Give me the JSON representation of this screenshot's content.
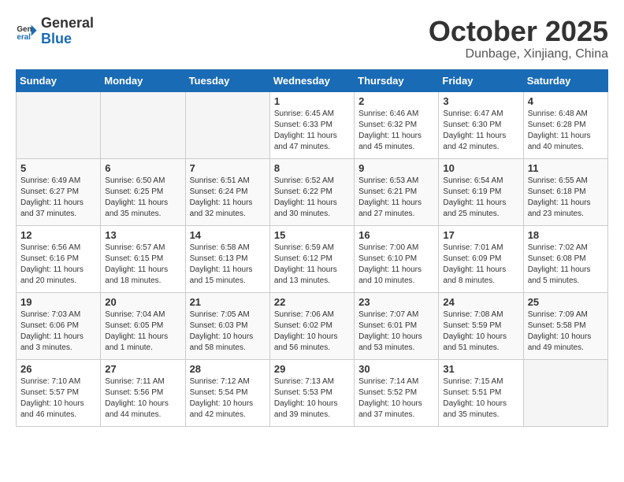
{
  "header": {
    "logo_line1": "General",
    "logo_line2": "Blue",
    "title": "October 2025",
    "subtitle": "Dunbage, Xinjiang, China"
  },
  "days_of_week": [
    "Sunday",
    "Monday",
    "Tuesday",
    "Wednesday",
    "Thursday",
    "Friday",
    "Saturday"
  ],
  "weeks": [
    [
      {
        "day": "",
        "empty": true
      },
      {
        "day": "",
        "empty": true
      },
      {
        "day": "",
        "empty": true
      },
      {
        "day": "1",
        "sunrise": "6:45 AM",
        "sunset": "6:33 PM",
        "daylight": "11 hours and 47 minutes."
      },
      {
        "day": "2",
        "sunrise": "6:46 AM",
        "sunset": "6:32 PM",
        "daylight": "11 hours and 45 minutes."
      },
      {
        "day": "3",
        "sunrise": "6:47 AM",
        "sunset": "6:30 PM",
        "daylight": "11 hours and 42 minutes."
      },
      {
        "day": "4",
        "sunrise": "6:48 AM",
        "sunset": "6:28 PM",
        "daylight": "11 hours and 40 minutes."
      }
    ],
    [
      {
        "day": "5",
        "sunrise": "6:49 AM",
        "sunset": "6:27 PM",
        "daylight": "11 hours and 37 minutes."
      },
      {
        "day": "6",
        "sunrise": "6:50 AM",
        "sunset": "6:25 PM",
        "daylight": "11 hours and 35 minutes."
      },
      {
        "day": "7",
        "sunrise": "6:51 AM",
        "sunset": "6:24 PM",
        "daylight": "11 hours and 32 minutes."
      },
      {
        "day": "8",
        "sunrise": "6:52 AM",
        "sunset": "6:22 PM",
        "daylight": "11 hours and 30 minutes."
      },
      {
        "day": "9",
        "sunrise": "6:53 AM",
        "sunset": "6:21 PM",
        "daylight": "11 hours and 27 minutes."
      },
      {
        "day": "10",
        "sunrise": "6:54 AM",
        "sunset": "6:19 PM",
        "daylight": "11 hours and 25 minutes."
      },
      {
        "day": "11",
        "sunrise": "6:55 AM",
        "sunset": "6:18 PM",
        "daylight": "11 hours and 23 minutes."
      }
    ],
    [
      {
        "day": "12",
        "sunrise": "6:56 AM",
        "sunset": "6:16 PM",
        "daylight": "11 hours and 20 minutes."
      },
      {
        "day": "13",
        "sunrise": "6:57 AM",
        "sunset": "6:15 PM",
        "daylight": "11 hours and 18 minutes."
      },
      {
        "day": "14",
        "sunrise": "6:58 AM",
        "sunset": "6:13 PM",
        "daylight": "11 hours and 15 minutes."
      },
      {
        "day": "15",
        "sunrise": "6:59 AM",
        "sunset": "6:12 PM",
        "daylight": "11 hours and 13 minutes."
      },
      {
        "day": "16",
        "sunrise": "7:00 AM",
        "sunset": "6:10 PM",
        "daylight": "11 hours and 10 minutes."
      },
      {
        "day": "17",
        "sunrise": "7:01 AM",
        "sunset": "6:09 PM",
        "daylight": "11 hours and 8 minutes."
      },
      {
        "day": "18",
        "sunrise": "7:02 AM",
        "sunset": "6:08 PM",
        "daylight": "11 hours and 5 minutes."
      }
    ],
    [
      {
        "day": "19",
        "sunrise": "7:03 AM",
        "sunset": "6:06 PM",
        "daylight": "11 hours and 3 minutes."
      },
      {
        "day": "20",
        "sunrise": "7:04 AM",
        "sunset": "6:05 PM",
        "daylight": "11 hours and 1 minute."
      },
      {
        "day": "21",
        "sunrise": "7:05 AM",
        "sunset": "6:03 PM",
        "daylight": "10 hours and 58 minutes."
      },
      {
        "day": "22",
        "sunrise": "7:06 AM",
        "sunset": "6:02 PM",
        "daylight": "10 hours and 56 minutes."
      },
      {
        "day": "23",
        "sunrise": "7:07 AM",
        "sunset": "6:01 PM",
        "daylight": "10 hours and 53 minutes."
      },
      {
        "day": "24",
        "sunrise": "7:08 AM",
        "sunset": "5:59 PM",
        "daylight": "10 hours and 51 minutes."
      },
      {
        "day": "25",
        "sunrise": "7:09 AM",
        "sunset": "5:58 PM",
        "daylight": "10 hours and 49 minutes."
      }
    ],
    [
      {
        "day": "26",
        "sunrise": "7:10 AM",
        "sunset": "5:57 PM",
        "daylight": "10 hours and 46 minutes."
      },
      {
        "day": "27",
        "sunrise": "7:11 AM",
        "sunset": "5:56 PM",
        "daylight": "10 hours and 44 minutes."
      },
      {
        "day": "28",
        "sunrise": "7:12 AM",
        "sunset": "5:54 PM",
        "daylight": "10 hours and 42 minutes."
      },
      {
        "day": "29",
        "sunrise": "7:13 AM",
        "sunset": "5:53 PM",
        "daylight": "10 hours and 39 minutes."
      },
      {
        "day": "30",
        "sunrise": "7:14 AM",
        "sunset": "5:52 PM",
        "daylight": "10 hours and 37 minutes."
      },
      {
        "day": "31",
        "sunrise": "7:15 AM",
        "sunset": "5:51 PM",
        "daylight": "10 hours and 35 minutes."
      },
      {
        "day": "",
        "empty": true
      }
    ]
  ]
}
